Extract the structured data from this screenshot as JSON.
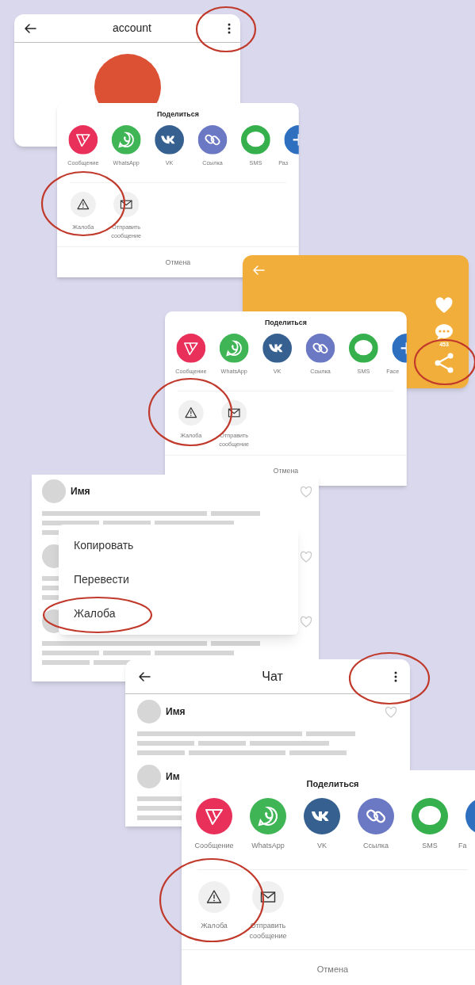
{
  "screens": [
    {
      "kind": "profile",
      "title": "account"
    },
    {
      "kind": "share_sheet",
      "title": "Поделиться",
      "apps": [
        {
          "label": "Сообщение",
          "color": "#e8305a"
        },
        {
          "label": "WhatsApp",
          "color": "#3fb556"
        },
        {
          "label": "VK",
          "color": "#35608f"
        },
        {
          "label": "Ссылка",
          "color": "#6b78c4"
        },
        {
          "label": "SMS",
          "color": "#35b04c"
        },
        {
          "label": "Раз",
          "color": "#2f6fc0"
        }
      ],
      "actions": [
        "Жалоба",
        "Отправить сообщение"
      ],
      "cancel": "Отмена"
    },
    {
      "kind": "post",
      "comment_count": "453"
    },
    {
      "kind": "share_sheet",
      "title": "Поделиться",
      "apps": [
        {
          "label": "Сообщение",
          "color": "#e8305a"
        },
        {
          "label": "WhatsApp",
          "color": "#3fb556"
        },
        {
          "label": "VK",
          "color": "#35608f"
        },
        {
          "label": "Ссылка",
          "color": "#6b78c4"
        },
        {
          "label": "SMS",
          "color": "#35b04c"
        },
        {
          "label": "Face",
          "color": "#2f6fc0"
        }
      ],
      "actions": [
        "Жалоба",
        "Отправить сообщение"
      ],
      "cancel": "Отмена"
    },
    {
      "kind": "comments",
      "items": [
        {
          "name": "Имя"
        }
      ],
      "menu": [
        "Копировать",
        "Перевести",
        "Жалоба"
      ]
    },
    {
      "kind": "chat",
      "title": "Чат",
      "messages": [
        {
          "name": "Имя"
        },
        {
          "name": "Им"
        }
      ]
    },
    {
      "kind": "share_sheet",
      "title": "Поделиться",
      "apps": [
        {
          "label": "Сообщение",
          "color": "#e8305a"
        },
        {
          "label": "WhatsApp",
          "color": "#3fb556"
        },
        {
          "label": "VK",
          "color": "#35608f"
        },
        {
          "label": "Ссылка",
          "color": "#6b78c4"
        },
        {
          "label": "SMS",
          "color": "#35b04c"
        },
        {
          "label": "Fa",
          "color": "#2f6fc0"
        }
      ],
      "actions": [
        "Жалоба",
        "Отправить сообщение"
      ],
      "cancel": "Отмена"
    }
  ]
}
